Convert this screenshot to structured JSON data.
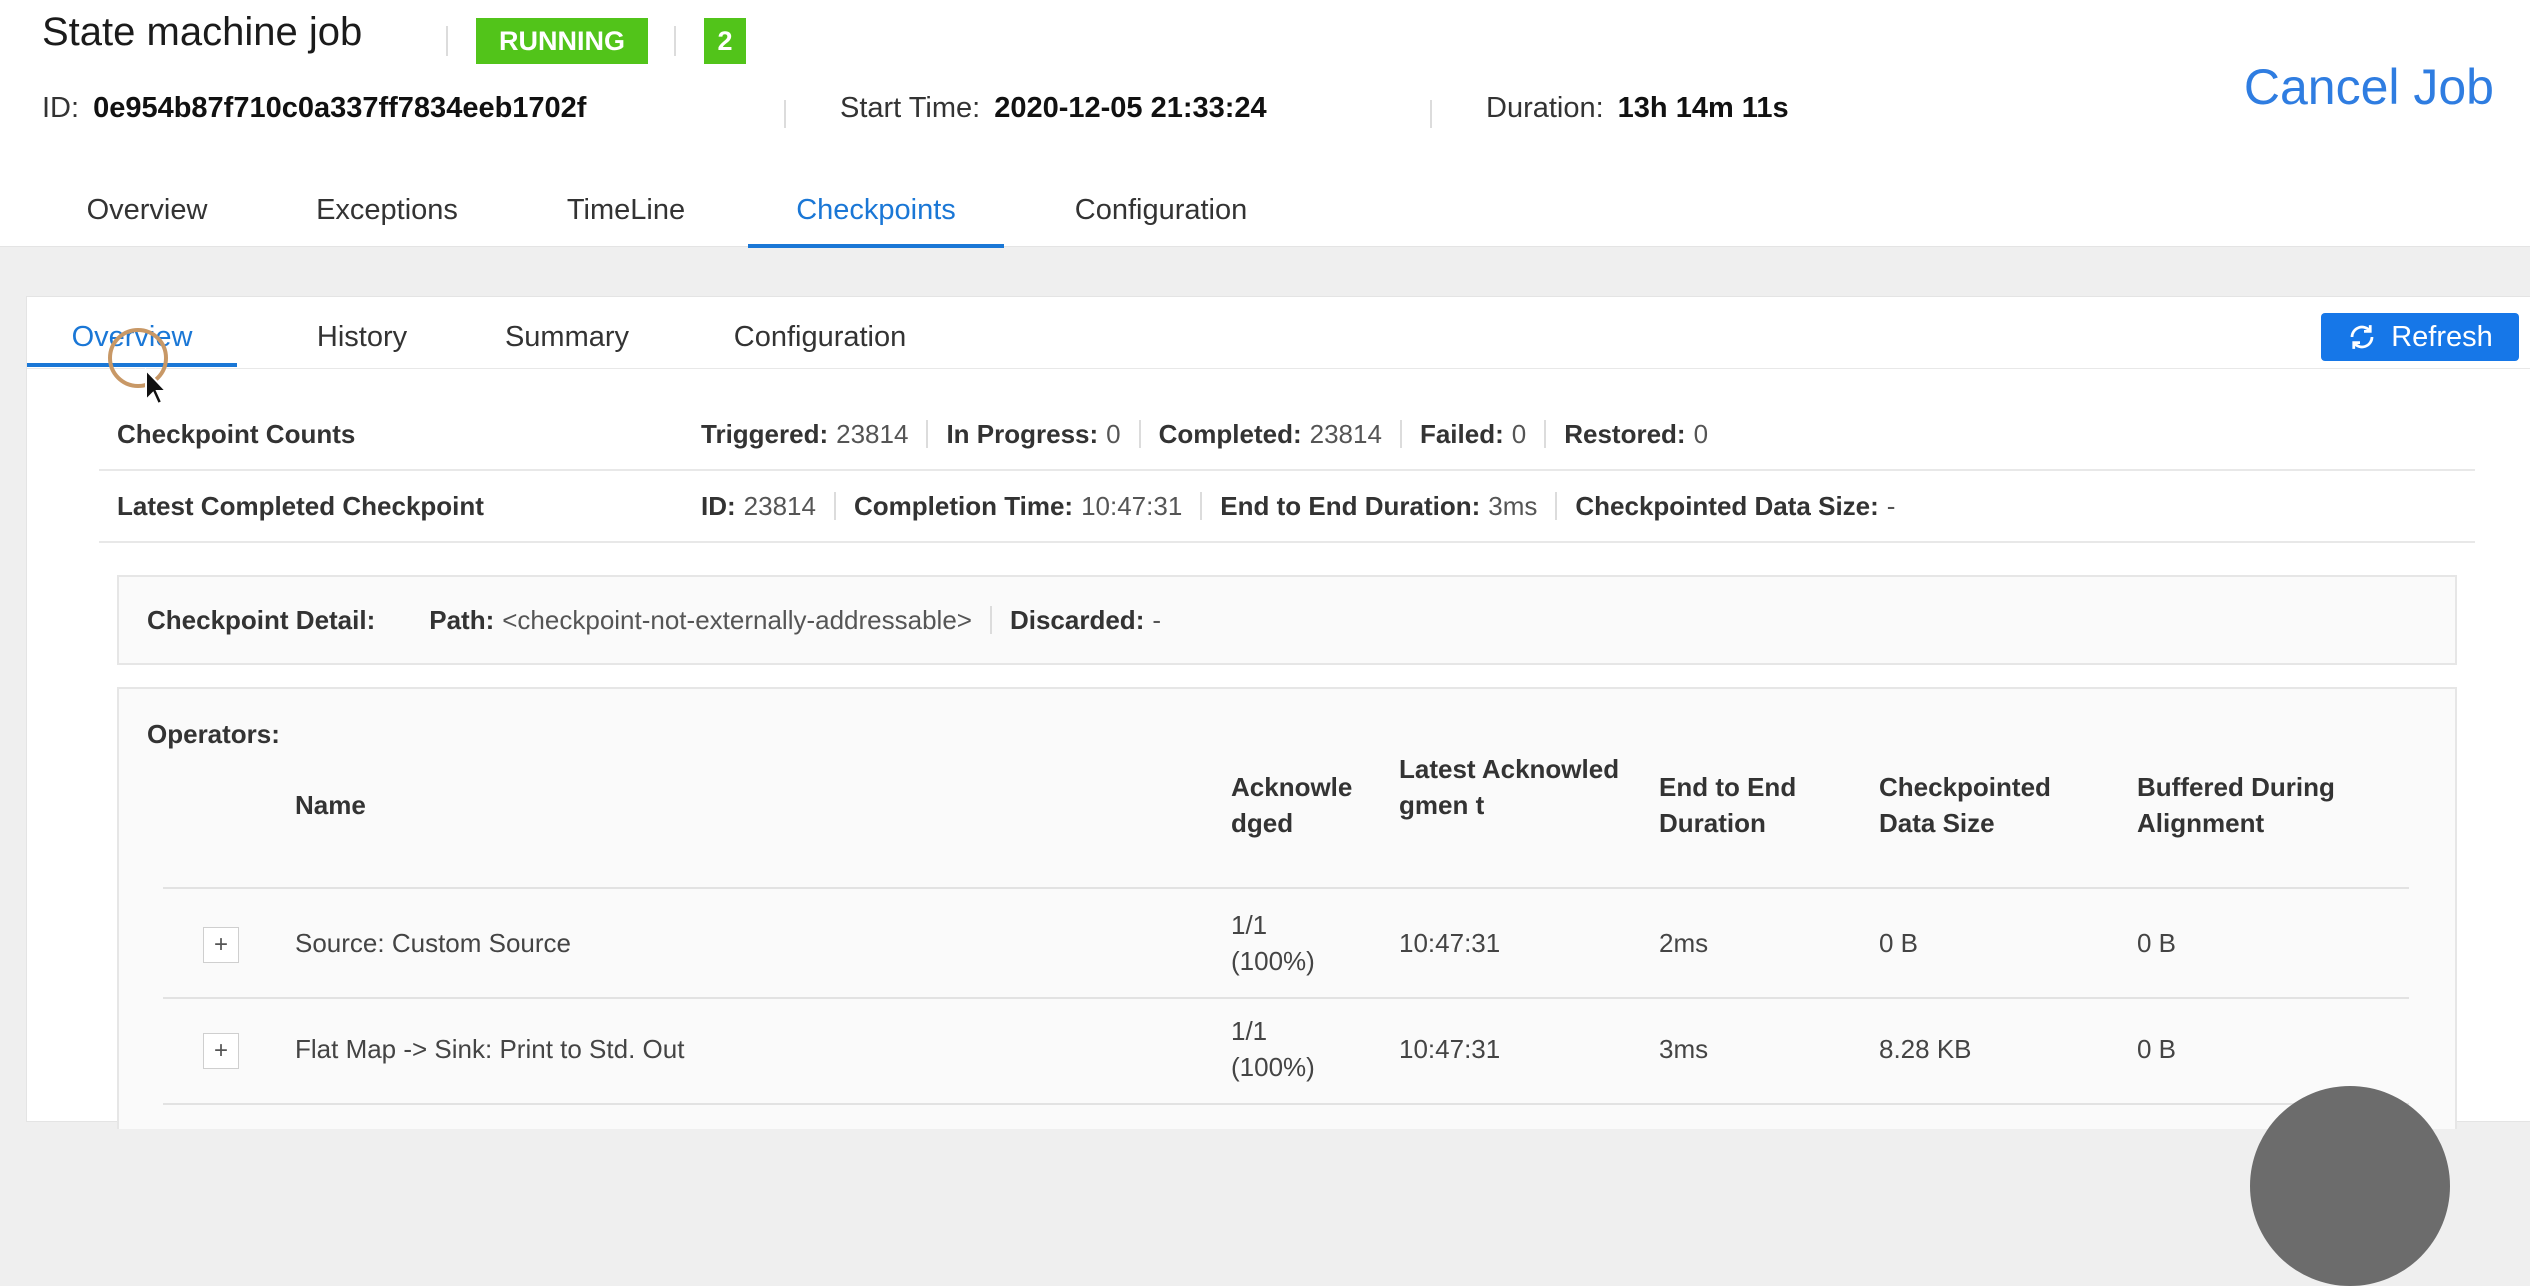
{
  "header": {
    "title": "State machine job",
    "status": "RUNNING",
    "count": "2",
    "id_label": "ID:",
    "id_value": "0e954b87f710c0a337ff7834eeb1702f",
    "start_label": "Start Time:",
    "start_value": "2020-12-05 21:33:24",
    "duration_label": "Duration:",
    "duration_value": "13h 14m 11s",
    "cancel_label": "Cancel Job",
    "status_color": "#52c41a",
    "accent_color": "#1a77d6"
  },
  "main_tabs": [
    "Overview",
    "Exceptions",
    "TimeLine",
    "Checkpoints",
    "Configuration"
  ],
  "sub_tabs": [
    "Overview",
    "History",
    "Summary",
    "Configuration"
  ],
  "refresh_label": "Refresh",
  "counts": {
    "label": "Checkpoint Counts",
    "triggered_k": "Triggered:",
    "triggered_v": "23814",
    "progress_k": "In Progress:",
    "progress_v": "0",
    "completed_k": "Completed:",
    "completed_v": "23814",
    "failed_k": "Failed:",
    "failed_v": "0",
    "restored_k": "Restored:",
    "restored_v": "0"
  },
  "latest": {
    "label": "Latest Completed Checkpoint",
    "id_k": "ID:",
    "id_v": "23814",
    "time_k": "Completion Time:",
    "time_v": "10:47:31",
    "e2e_k": "End to End Duration:",
    "e2e_v": "3ms",
    "size_k": "Checkpointed Data Size:",
    "size_v": "-"
  },
  "detail": {
    "label": "Checkpoint Detail:",
    "path_k": "Path:",
    "path_v": "<checkpoint-not-externally-addressable>",
    "discarded_k": "Discarded:",
    "discarded_v": "-"
  },
  "operators": {
    "title": "Operators:",
    "columns": {
      "name": "Name",
      "ack": "Acknowle dged",
      "latest": "Latest Acknowledgmen t",
      "e2e": "End to End Duration",
      "size": "Checkpointed Data Size",
      "buffered": "Buffered During Alignment"
    },
    "rows": [
      {
        "expand": "+",
        "name": "Source: Custom Source",
        "ack": "1/1 (100%)",
        "latest": "10:47:31",
        "e2e": "2ms",
        "size": "0 B",
        "buffered": "0 B"
      },
      {
        "expand": "+",
        "name": "Flat Map -> Sink: Print to Std. Out",
        "ack": "1/1 (100%)",
        "latest": "10:47:31",
        "e2e": "3ms",
        "size": "8.28 KB",
        "buffered": "0 B"
      }
    ]
  }
}
